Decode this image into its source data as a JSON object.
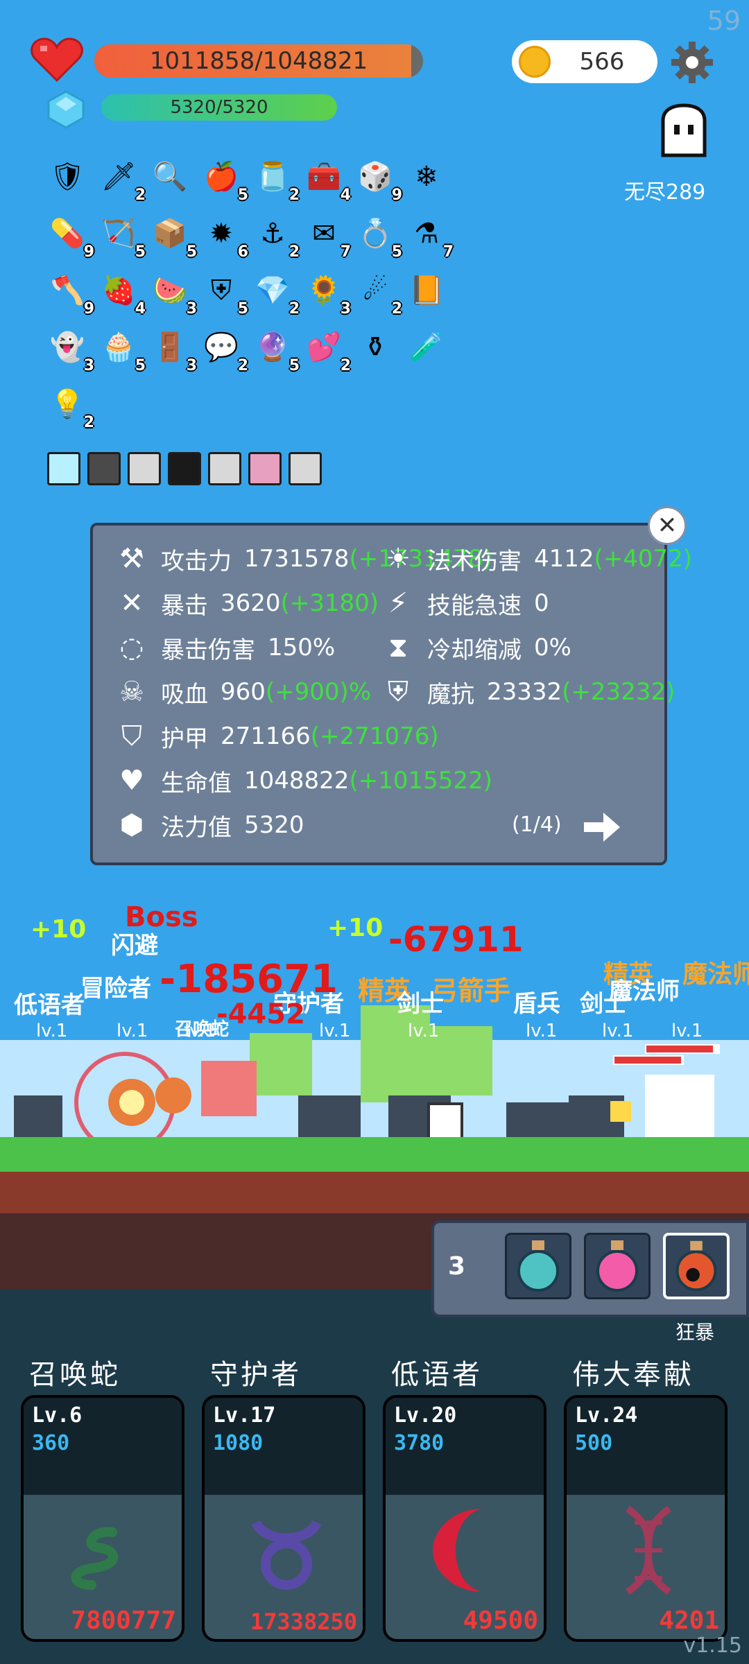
{
  "fps": "59",
  "hp": {
    "text": "1011858/1048821",
    "fraction": 0.965
  },
  "mana": {
    "text": "5320/5320",
    "fraction": 1.0
  },
  "coins": "566",
  "mode_label": "无尽289",
  "items": [
    {
      "icon": "shield-icon",
      "count": ""
    },
    {
      "icon": "sword-icon",
      "count": "2"
    },
    {
      "icon": "magnifier-icon",
      "count": ""
    },
    {
      "icon": "apple-icon",
      "count": "5"
    },
    {
      "icon": "jam-jar-icon",
      "count": "2"
    },
    {
      "icon": "chest-purple-icon",
      "count": "4"
    },
    {
      "icon": "dice-icon",
      "count": "9"
    },
    {
      "icon": "snowflake-icon",
      "count": ""
    },
    {
      "icon": "pill-icon",
      "count": "9"
    },
    {
      "icon": "bow-icon",
      "count": "5"
    },
    {
      "icon": "treasure-chest-icon",
      "count": "5"
    },
    {
      "icon": "spiked-ball-icon",
      "count": "6"
    },
    {
      "icon": "hook-icon",
      "count": "2"
    },
    {
      "icon": "envelope-icon",
      "count": "7"
    },
    {
      "icon": "ring-icon",
      "count": "5"
    },
    {
      "icon": "potion-flask-icon",
      "count": "7"
    },
    {
      "icon": "axe-icon",
      "count": "9"
    },
    {
      "icon": "strawberry-icon",
      "count": "4"
    },
    {
      "icon": "watermelon-icon",
      "count": "3"
    },
    {
      "icon": "shield-red-icon",
      "count": "5"
    },
    {
      "icon": "gem-icon",
      "count": "2"
    },
    {
      "icon": "sunflower-icon",
      "count": "3"
    },
    {
      "icon": "meteor-icon",
      "count": "2"
    },
    {
      "icon": "book-icon",
      "count": ""
    },
    {
      "icon": "ghost-icon",
      "count": "3"
    },
    {
      "icon": "cupcake-icon",
      "count": "5"
    },
    {
      "icon": "door-icon",
      "count": "3"
    },
    {
      "icon": "speech-bubble-icon",
      "count": "2"
    },
    {
      "icon": "crystal-ball-icon",
      "count": "5"
    },
    {
      "icon": "hearts-icon",
      "count": "2"
    },
    {
      "icon": "cauldron-icon",
      "count": ""
    },
    {
      "icon": "spirit-icon",
      "count": ""
    },
    {
      "icon": "lightbulb-icon",
      "count": "2"
    }
  ],
  "equip_slots": [
    "glow-slot-icon",
    "blade-slot-icon",
    "armor-slot-icon",
    "crown-slot-icon",
    "armor-slot-icon",
    "boot-slot-icon",
    "armor-slot-icon"
  ],
  "stats": {
    "left": [
      {
        "icon": "axe-stat-icon",
        "label": "攻击力",
        "value": "1731578",
        "bonus": "(+1731478)"
      },
      {
        "icon": "crossed-swords-icon",
        "label": "暴击",
        "value": "3620",
        "bonus": "(+3180)"
      },
      {
        "icon": "crit-ring-icon",
        "label": "暴击伤害",
        "value": "150%",
        "bonus": ""
      },
      {
        "icon": "skull-icon",
        "label": "吸血",
        "value": "960",
        "bonus": "(+900)%"
      },
      {
        "icon": "armor-stat-icon",
        "label": "护甲",
        "value": "271166",
        "bonus": "(+271076)"
      },
      {
        "icon": "heart-stat-icon",
        "label": "生命值",
        "value": "1048822",
        "bonus": "(+1015522)"
      },
      {
        "icon": "mana-stat-icon",
        "label": "法力值",
        "value": "5320",
        "bonus": ""
      }
    ],
    "right": [
      {
        "icon": "sun-stat-icon",
        "label": "法术伤害",
        "value": "4112",
        "bonus": "(+4072)"
      },
      {
        "icon": "lightning-icon",
        "label": "技能急速",
        "value": "0",
        "bonus": ""
      },
      {
        "icon": "hourglass-icon",
        "label": "冷却缩减",
        "value": "0%",
        "bonus": ""
      },
      {
        "icon": "magic-shield-icon",
        "label": "魔抗",
        "value": "23332",
        "bonus": "(+23232)"
      }
    ],
    "pager": "(1/4)"
  },
  "battle": {
    "floats": [
      {
        "text": "+10",
        "cls": "green"
      },
      {
        "text": "Boss",
        "cls": "red"
      },
      {
        "text": "+10",
        "cls": "green"
      },
      {
        "text": "-67911",
        "cls": "red"
      },
      {
        "text": "闪避",
        "cls": "white"
      },
      {
        "text": "冒险者",
        "cls": "white"
      },
      {
        "text": "低语者",
        "cls": "white"
      },
      {
        "text": "精英",
        "cls": "orange"
      },
      {
        "text": "弓箭手",
        "cls": "orange"
      },
      {
        "text": "盾兵",
        "cls": "white"
      },
      {
        "text": "剑士",
        "cls": "white"
      },
      {
        "text": "精英",
        "cls": "orange"
      },
      {
        "text": "魔法师",
        "cls": "orange"
      },
      {
        "text": "魔法师",
        "cls": "white"
      },
      {
        "text": "守护者",
        "cls": "white"
      },
      {
        "text": "剑士",
        "cls": "white"
      },
      {
        "text": "-185671",
        "cls": "red"
      },
      {
        "text": "-4452",
        "cls": "red"
      },
      {
        "text": "召唤蛇",
        "cls": "white"
      }
    ],
    "levels": [
      "lv.1",
      "lv.1",
      "lv.1",
      "lv.1",
      "lv.1",
      "lv.1",
      "lv.1",
      "lv.1"
    ]
  },
  "potions": {
    "count": "3",
    "label": "狂暴"
  },
  "skills": [
    {
      "title": "召唤蛇",
      "level": "Lv.6",
      "cost": "360",
      "damage": "7800777",
      "emblem": "snake-icon",
      "color": "#2f7a4a"
    },
    {
      "title": "守护者",
      "level": "Lv.17",
      "cost": "1080",
      "damage": "17338250",
      "emblem": "taurus-icon",
      "color": "#5a4aa8"
    },
    {
      "title": "低语者",
      "level": "Lv.20",
      "cost": "3780",
      "damage": "49500",
      "emblem": "crescent-moon-icon",
      "color": "#d8203a"
    },
    {
      "title": "伟大奉献",
      "level": "Lv.24",
      "cost": "500",
      "damage": "4201",
      "emblem": "dna-icon",
      "color": "#a23a5a"
    }
  ],
  "version": "v1.15"
}
